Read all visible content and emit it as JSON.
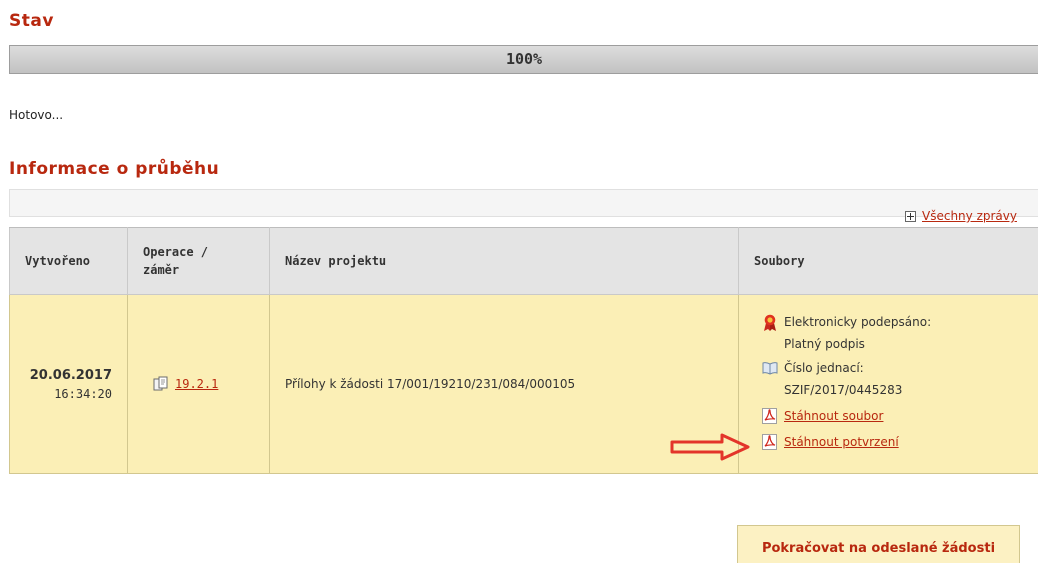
{
  "status_section": {
    "title": "Stav",
    "progress_percent": 100,
    "progress_label": "100%",
    "status_text": "Hotovo..."
  },
  "info_section": {
    "title": "Informace o průběhu",
    "all_messages_link": "Všechny zprávy"
  },
  "table": {
    "headers": {
      "created": [
        "Vytvořeno"
      ],
      "operation": [
        "Operace /",
        "záměr"
      ],
      "project": [
        "Název projektu"
      ],
      "files": [
        "Soubory"
      ]
    },
    "rows": [
      {
        "date": "20.06.2017",
        "time": "16:34:20",
        "operation": "19.2.1",
        "project_name": "Přílohy k žádosti 17/001/19210/231/084/000105",
        "signed_label": "Elektronicky podepsáno:",
        "signed_value": "Platný podpis",
        "ref_label": "Číslo jednací:",
        "ref_value": "SZIF/2017/0445283",
        "download_file": "Stáhnout soubor",
        "download_confirmation": "Stáhnout potvrzení"
      }
    ]
  },
  "continue_button": "Pokračovat na odeslané žádosti",
  "colors": {
    "accent": "#b8280f",
    "row_background": "#fbefb6",
    "header_background": "#e4e4e4",
    "arrow": "#e3342a"
  },
  "icons": {
    "operation": "documents-icon",
    "signed": "award-ribbon-icon",
    "reference": "open-book-icon",
    "download": "pdf-icon",
    "expand": "plus-box-icon",
    "pointer": "red-arrow-icon"
  }
}
